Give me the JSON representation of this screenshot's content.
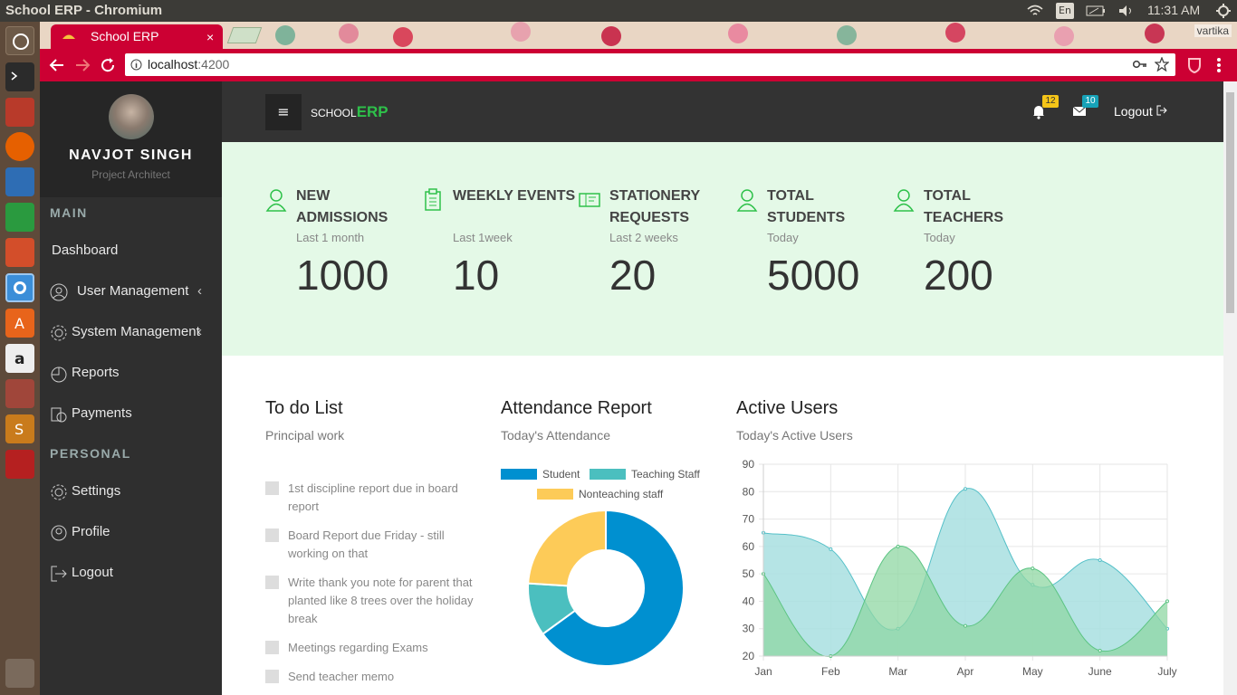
{
  "os": {
    "window_title": "School ERP - Chromium",
    "lang": "En",
    "clock": "11:31 AM"
  },
  "browser": {
    "tab_title": "School ERP",
    "tab_close": "×",
    "url_host": "localhost",
    "url_port": ":4200",
    "profile_name": "vartika"
  },
  "sidebar": {
    "user_name": "NAVJOT SINGH",
    "user_role": "Project Architect",
    "main_heading": "MAIN",
    "personal_heading": "PERSONAL",
    "items": [
      {
        "label": "Dashboard",
        "icon": "none"
      },
      {
        "label": "User Management",
        "icon": "user-circle-icon",
        "chevron": "‹"
      },
      {
        "label": "System Management",
        "icon": "gear-icon",
        "chevron": "‹"
      },
      {
        "label": "Reports",
        "icon": "pie-chart-icon"
      },
      {
        "label": "Payments",
        "icon": "payments-icon"
      },
      {
        "label": "Settings",
        "icon": "gear-icon"
      },
      {
        "label": "Profile",
        "icon": "profile-icon"
      },
      {
        "label": "Logout",
        "icon": "logout-icon"
      }
    ]
  },
  "header": {
    "menu_glyph": "≡",
    "brand_small": "SCHOOL",
    "brand_big": "ERP",
    "notifications_count": "12",
    "messages_count": "10",
    "logout_label": "Logout",
    "accent": "#2ec14a"
  },
  "stats": [
    {
      "title": "NEW ADMISSIONS",
      "period": "Last 1 month",
      "value": "1000",
      "icon": "user-icon"
    },
    {
      "title": "WEEKLY EVENTS",
      "period": "Last 1week",
      "value": "10",
      "icon": "clipboard-icon"
    },
    {
      "title": "STATIONERY REQUESTS",
      "period": "Last 2 weeks",
      "value": "20",
      "icon": "ticket-icon"
    },
    {
      "title": "TOTAL STUDENTS",
      "period": "Today",
      "value": "5000",
      "icon": "user-icon"
    },
    {
      "title": "TOTAL TEACHERS",
      "period": "Today",
      "value": "200",
      "icon": "user-icon"
    }
  ],
  "todo": {
    "title": "To do List",
    "subtitle": "Principal work",
    "items": [
      "1st discipline report due in board report",
      "Board Report due Friday - still working on that",
      "Write thank you note for parent that planted like 8 trees over the holiday break",
      "Meetings regarding Exams",
      "Send teacher memo"
    ]
  },
  "attendance": {
    "title": "Attendance Report",
    "subtitle": "Today's Attendance"
  },
  "active_users": {
    "title": "Active Users",
    "subtitle": "Today's Active Users"
  },
  "chart_data": [
    {
      "type": "pie",
      "variant": "doughnut",
      "labels": [
        "Student",
        "Teaching Staff",
        "Nonteaching staff"
      ],
      "values": [
        65,
        11,
        24
      ],
      "colors": [
        "#0090d0",
        "#4bbfbf",
        "#fdcb58"
      ]
    },
    {
      "type": "area",
      "categories": [
        "Jan",
        "Feb",
        "Mar",
        "Apr",
        "May",
        "June",
        "July"
      ],
      "ylim": [
        20,
        90
      ],
      "yticks": [
        "90",
        "80",
        "70",
        "60",
        "50",
        "40",
        "30",
        "20"
      ],
      "grid": true,
      "series": [
        {
          "values": [
            65,
            59,
            30,
            81,
            46,
            55,
            30
          ],
          "color": "#a8dfe0"
        },
        {
          "values": [
            50,
            20,
            60,
            31,
            52,
            22,
            40
          ],
          "color": "#8fd7a3"
        }
      ]
    }
  ]
}
